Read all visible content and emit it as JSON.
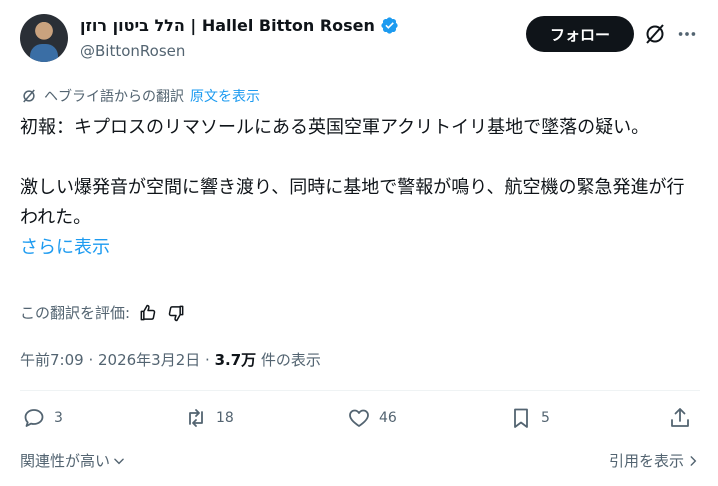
{
  "author": {
    "display_name": "הלל ביטון רוזן | Hallel Bitton Rosen",
    "handle": "@BittonRosen"
  },
  "follow_button": {
    "label": "フォロー"
  },
  "translation": {
    "source_label": "ヘブライ語からの翻訳",
    "show_original": "原文を表示"
  },
  "tweet": {
    "paragraph1": "初報：キプロスのリマソールにある英国空軍アクリトイリ基地で墜落の疑い。",
    "paragraph2": "激しい爆発音が空間に響き渡り、同時に基地で警報が鳴り、航空機の緊急発進が行われた。",
    "show_more": "さらに表示"
  },
  "rating": {
    "label": "この翻訳を評価:"
  },
  "meta": {
    "time": "午前7:09",
    "date": "2026年3月2日",
    "views_count": "3.7万",
    "views_label": " 件の表示",
    "sep": " · "
  },
  "actions": {
    "replies": "3",
    "reposts": "18",
    "likes": "46",
    "bookmarks": "5"
  },
  "footer": {
    "relevance": "関連性が高い",
    "quotes": "引用を表示"
  },
  "colors": {
    "accent": "#1d9bf0",
    "text": "#0f1419",
    "secondary": "#536471"
  }
}
